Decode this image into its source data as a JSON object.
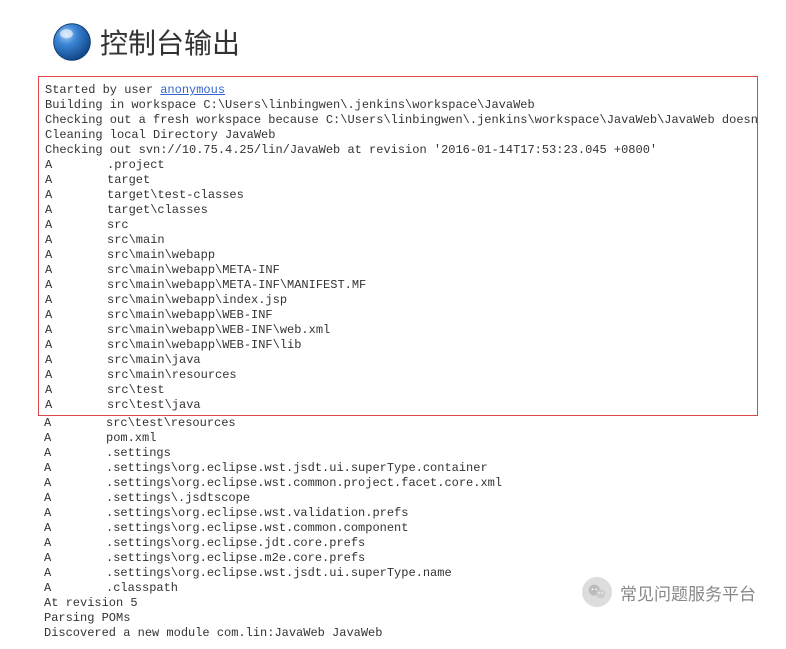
{
  "header": {
    "title": "控制台输出"
  },
  "console": {
    "started_prefix": "Started by user ",
    "user_link": "anonymous",
    "building_line": "Building in workspace C:\\Users\\linbingwen\\.jenkins\\workspace\\JavaWeb",
    "checking_fresh": "Checking out a fresh workspace because C:\\Users\\linbingwen\\.jenkins\\workspace\\JavaWeb\\JavaWeb doesn't exist",
    "cleaning": "Cleaning local Directory JavaWeb",
    "checking_out": "Checking out svn://10.75.4.25/lin/JavaWeb at revision '2016-01-14T17:53:23.045 +0800'",
    "files_a": [
      ".project",
      "target",
      "target\\test-classes",
      "target\\classes",
      "src",
      "src\\main",
      "src\\main\\webapp",
      "src\\main\\webapp\\META-INF",
      "src\\main\\webapp\\META-INF\\MANIFEST.MF",
      "src\\main\\webapp\\index.jsp",
      "src\\main\\webapp\\WEB-INF",
      "src\\main\\webapp\\WEB-INF\\web.xml",
      "src\\main\\webapp\\WEB-INF\\lib",
      "src\\main\\java",
      "src\\main\\resources",
      "src\\test",
      "src\\test\\java"
    ],
    "files_b": [
      "src\\test\\resources",
      "pom.xml",
      ".settings",
      ".settings\\org.eclipse.wst.jsdt.ui.superType.container",
      ".settings\\org.eclipse.wst.common.project.facet.core.xml",
      ".settings\\.jsdtscope",
      ".settings\\org.eclipse.wst.validation.prefs",
      ".settings\\org.eclipse.wst.common.component",
      ".settings\\org.eclipse.jdt.core.prefs",
      ".settings\\org.eclipse.m2e.core.prefs",
      ".settings\\org.eclipse.wst.jsdt.ui.superType.name",
      ".classpath"
    ],
    "at_revision": "At revision 5",
    "parsing": "Parsing POMs",
    "discovered": "Discovered a new module com.lin:JavaWeb JavaWeb",
    "flag": "A"
  },
  "watermark": {
    "text": "常见问题服务平台"
  }
}
